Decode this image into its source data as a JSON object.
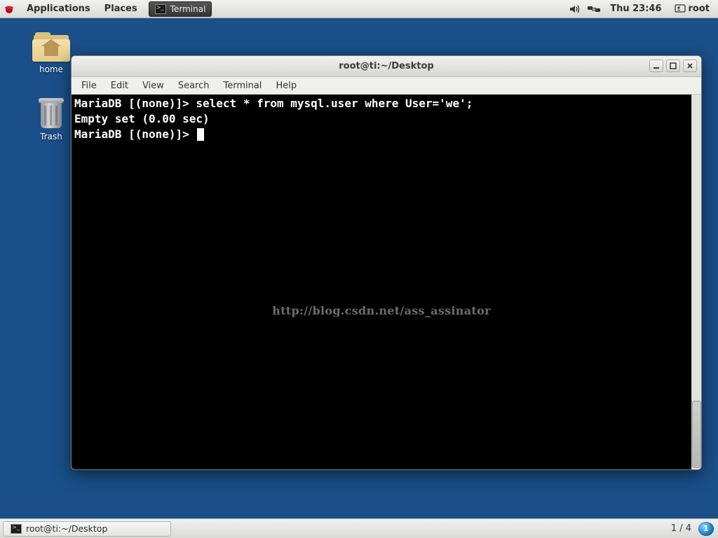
{
  "top_panel": {
    "applications_label": "Applications",
    "places_label": "Places",
    "running_app_label": "Terminal",
    "clock": "Thu 23:46",
    "user": "root"
  },
  "desktop": {
    "home_label": "home",
    "trash_label": "Trash"
  },
  "window": {
    "title": "root@ti:~/Desktop",
    "menubar": [
      "File",
      "Edit",
      "View",
      "Search",
      "Terminal",
      "Help"
    ],
    "term_line1": "MariaDB [(none)]> select * from mysql.user where User='we';",
    "term_line2": "Empty set (0.00 sec)",
    "term_line3": "",
    "term_prompt": "MariaDB [(none)]>",
    "watermark": "http://blog.csdn.net/ass_assinator"
  },
  "bottom_panel": {
    "task_label": "root@ti:~/Desktop",
    "paging": "1 / 4",
    "workspace": "1"
  }
}
